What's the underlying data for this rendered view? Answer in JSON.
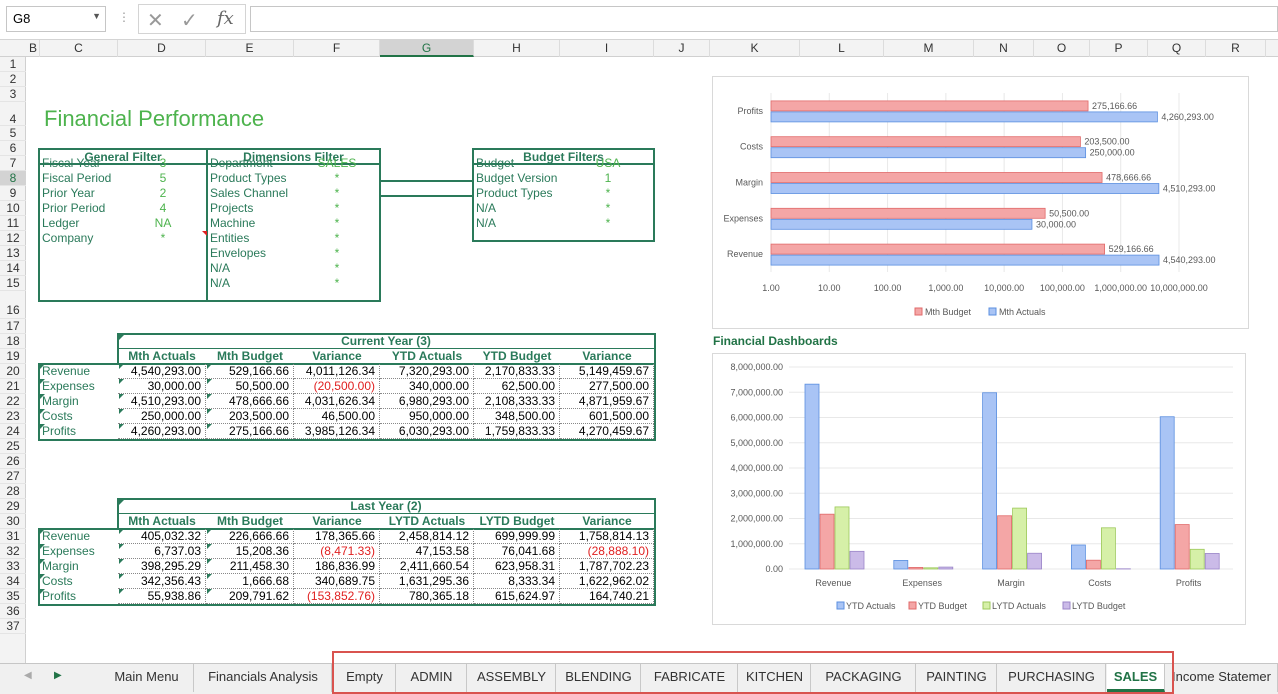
{
  "formula_bar": {
    "name_box": "G8",
    "cancel_icon": "✕",
    "enter_icon": "✓",
    "fx_label": "fx",
    "formula": ""
  },
  "columns": [
    "B",
    "C",
    "D",
    "E",
    "F",
    "G",
    "H",
    "I",
    "J",
    "K",
    "L",
    "M",
    "N",
    "O",
    "P",
    "Q",
    "R"
  ],
  "rows": [
    "1",
    "2",
    "3",
    "4",
    "5",
    "6",
    "7",
    "8",
    "9",
    "10",
    "11",
    "12",
    "13",
    "14",
    "15",
    "16",
    "17",
    "18",
    "19",
    "20",
    "21",
    "22",
    "23",
    "24",
    "25",
    "26",
    "27",
    "28",
    "29",
    "30",
    "31",
    "32",
    "33",
    "34",
    "35",
    "36",
    "37"
  ],
  "title": "Financial Performance",
  "general_filter": {
    "header": "General Filter",
    "items": [
      {
        "label": "Fiscal Year",
        "value": "3"
      },
      {
        "label": "Fiscal Period",
        "value": "5"
      },
      {
        "label": "Prior Year",
        "value": "2"
      },
      {
        "label": "Prior Period",
        "value": "4"
      },
      {
        "label": "Ledger",
        "value": "NA"
      },
      {
        "label": "Company",
        "value": "*"
      }
    ]
  },
  "dimensions_filter": {
    "header": "Dimensions Filter",
    "items": [
      {
        "label": "Department",
        "value": "SALES"
      },
      {
        "label": "Product Types",
        "value": "*"
      },
      {
        "label": "Sales Channel",
        "value": "*"
      },
      {
        "label": "Projects",
        "value": "*"
      },
      {
        "label": "Machine",
        "value": "*"
      },
      {
        "label": "Entities",
        "value": "*"
      },
      {
        "label": "Envelopes",
        "value": "*"
      },
      {
        "label": "N/A",
        "value": "*"
      },
      {
        "label": "N/A",
        "value": "*"
      }
    ]
  },
  "budget_filters": {
    "header": "Budget Filters",
    "items": [
      {
        "label": "Budget",
        "value": "USA"
      },
      {
        "label": "Budget Version",
        "value": "1"
      },
      {
        "label": "Product Types",
        "value": "*"
      },
      {
        "label": "N/A",
        "value": "*"
      },
      {
        "label": "N/A",
        "value": "*"
      }
    ]
  },
  "current_year": {
    "title": "Current Year (3)",
    "headers": [
      "Mth Actuals",
      "Mth Budget",
      "Variance",
      "YTD Actuals",
      "YTD Budget",
      "Variance"
    ],
    "rows": [
      {
        "label": "Revenue",
        "cells": [
          "4,540,293.00",
          "529,166.66",
          "4,011,126.34",
          "7,320,293.00",
          "2,170,833.33",
          "5,149,459.67"
        ]
      },
      {
        "label": "Expenses",
        "cells": [
          "30,000.00",
          "50,500.00",
          "(20,500.00)",
          "340,000.00",
          "62,500.00",
          "277,500.00"
        ]
      },
      {
        "label": "Margin",
        "cells": [
          "4,510,293.00",
          "478,666.66",
          "4,031,626.34",
          "6,980,293.00",
          "2,108,333.33",
          "4,871,959.67"
        ]
      },
      {
        "label": "Costs",
        "cells": [
          "250,000.00",
          "203,500.00",
          "46,500.00",
          "950,000.00",
          "348,500.00",
          "601,500.00"
        ]
      },
      {
        "label": "Profits",
        "cells": [
          "4,260,293.00",
          "275,166.66",
          "3,985,126.34",
          "6,030,293.00",
          "1,759,833.33",
          "4,270,459.67"
        ]
      }
    ]
  },
  "last_year": {
    "title": "Last Year (2)",
    "headers": [
      "Mth Actuals",
      "Mth Budget",
      "Variance",
      "LYTD Actuals",
      "LYTD Budget",
      "Variance"
    ],
    "rows": [
      {
        "label": "Revenue",
        "cells": [
          "405,032.32",
          "226,666.66",
          "178,365.66",
          "2,458,814.12",
          "699,999.99",
          "1,758,814.13"
        ]
      },
      {
        "label": "Expenses",
        "cells": [
          "6,737.03",
          "15,208.36",
          "(8,471.33)",
          "47,153.58",
          "76,041.68",
          "(28,888.10)"
        ]
      },
      {
        "label": "Margin",
        "cells": [
          "398,295.29",
          "211,458.30",
          "186,836.99",
          "2,411,660.54",
          "623,958.31",
          "1,787,702.23"
        ]
      },
      {
        "label": "Costs",
        "cells": [
          "342,356.43",
          "1,666.68",
          "340,689.75",
          "1,631,295.36",
          "8,333.34",
          "1,622,962.02"
        ]
      },
      {
        "label": "Profits",
        "cells": [
          "55,938.86",
          "209,791.62",
          "(153,852.76)",
          "780,365.18",
          "615,624.97",
          "164,740.21"
        ]
      }
    ]
  },
  "dashboard_label": "Financial Dashboards",
  "chart_data": [
    {
      "type": "bar",
      "orientation": "horizontal",
      "scale": "log",
      "categories": [
        "Profits",
        "Costs",
        "Margin",
        "Expenses",
        "Revenue"
      ],
      "series": [
        {
          "name": "Mth Budget",
          "color": "#f4a6a6",
          "values": [
            275166.66,
            203500,
            478666.66,
            50500,
            529166.66
          ],
          "labels": [
            "275,166.66",
            "203,500.00",
            "478,666.66",
            "50,500.00",
            "529,166.66"
          ]
        },
        {
          "name": "Mth Actuals",
          "color": "#a9c4f5",
          "values": [
            4260293,
            250000,
            4510293,
            30000,
            4540293
          ],
          "labels": [
            "4,260,293.00",
            "250,000.00",
            "4,510,293.00",
            "30,000.00",
            "4,540,293.00"
          ]
        }
      ],
      "x_ticks": [
        "1.00",
        "10.00",
        "100.00",
        "1,000.00",
        "10,000.00",
        "100,000.00",
        "1,000,000.00",
        "10,000,000.00"
      ],
      "legend": "bottom"
    },
    {
      "type": "bar",
      "categories": [
        "Revenue",
        "Expenses",
        "Margin",
        "Costs",
        "Profits"
      ],
      "series": [
        {
          "name": "YTD Actuals",
          "color": "#a9c4f5",
          "values": [
            7320293,
            340000,
            6980293,
            950000,
            6030293
          ]
        },
        {
          "name": "YTD Budget",
          "color": "#f4a6a6",
          "values": [
            2170833.33,
            62500,
            2108333.33,
            348500,
            1759833.33
          ]
        },
        {
          "name": "LYTD Actuals",
          "color": "#d6f0a8",
          "values": [
            2458814.12,
            47153.58,
            2411660.54,
            1631295.36,
            780365.18
          ]
        },
        {
          "name": "LYTD Budget",
          "color": "#cbbbe8",
          "values": [
            699999.99,
            76041.68,
            623958.31,
            8333.34,
            615624.97
          ]
        }
      ],
      "y_ticks": [
        "8,000,000.00",
        "7,000,000.00",
        "6,000,000.00",
        "5,000,000.00",
        "4,000,000.00",
        "3,000,000.00",
        "2,000,000.00",
        "1,000,000.00",
        "0.00"
      ],
      "ylim": [
        0,
        8000000
      ],
      "legend": "bottom"
    }
  ],
  "sheet_tabs": [
    "Main Menu",
    "Financials Analysis",
    "Empty",
    "ADMIN",
    "ASSEMBLY",
    "BLENDING",
    "FABRICATE",
    "KITCHEN",
    "PACKAGING",
    "PAINTING",
    "PURCHASING",
    "SALES",
    "Income Statemer"
  ],
  "active_tab": "SALES"
}
